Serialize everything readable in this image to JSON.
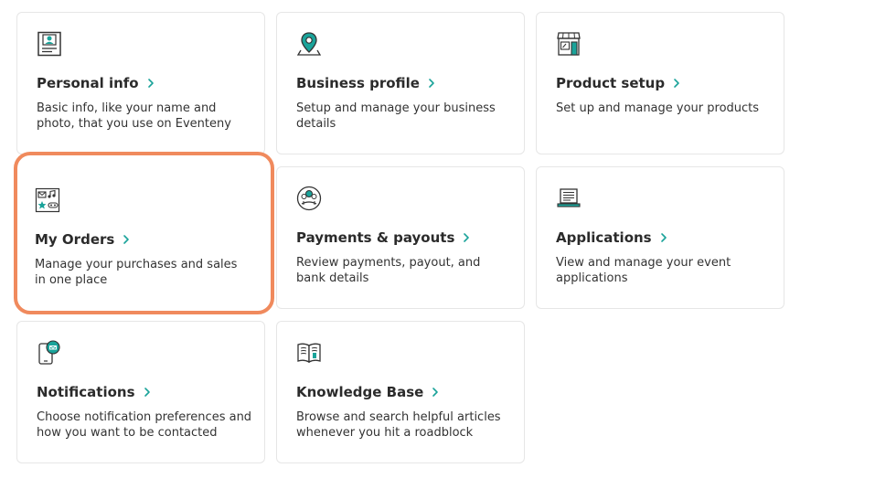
{
  "colors": {
    "accent_teal": "#1aa39a",
    "icon_dark": "#333333",
    "highlight_border": "#f08a5d"
  },
  "cards": [
    {
      "title": "Personal info",
      "desc": "Basic info, like your name and photo, that you use on Eventeny",
      "icon": "id-card-icon"
    },
    {
      "title": "Business profile",
      "desc": "Setup and manage your business details",
      "icon": "map-pin-icon"
    },
    {
      "title": "Product setup",
      "desc": "Set up and manage your products",
      "icon": "storefront-icon"
    },
    {
      "title": "My Orders",
      "desc": "Manage your purchases and sales in one place",
      "icon": "orders-icon"
    },
    {
      "title": "Payments & payouts",
      "desc": "Review payments, payout, and bank details",
      "icon": "payments-icon"
    },
    {
      "title": "Applications",
      "desc": "View and manage your event applications",
      "icon": "laptop-icon"
    },
    {
      "title": "Notifications",
      "desc": "Choose notification preferences and how you want to be contacted",
      "icon": "notification-icon"
    },
    {
      "title": "Knowledge Base",
      "desc": "Browse and search helpful articles whenever you hit a roadblock",
      "icon": "book-icon"
    }
  ]
}
